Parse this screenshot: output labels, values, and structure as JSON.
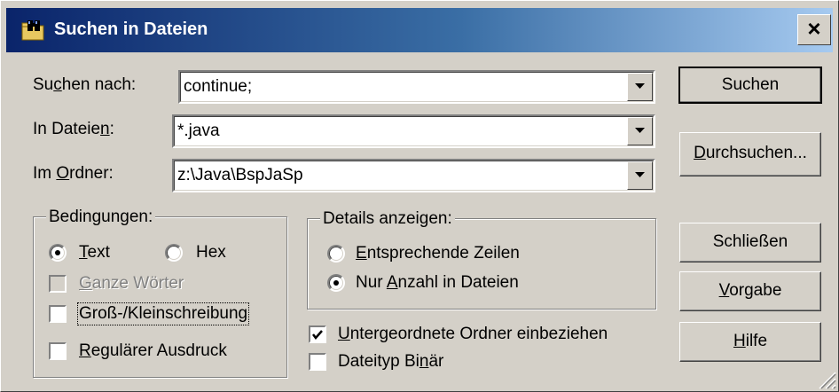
{
  "window": {
    "title": "Suchen in Dateien",
    "title_icon": "binoculars-folder-icon",
    "close_glyph": "×"
  },
  "fields": {
    "search": {
      "label_pre": "Su",
      "label_key": "c",
      "label_post": "hen nach:",
      "value": "continue;"
    },
    "files": {
      "label_pre": "In Dateie",
      "label_key": "n",
      "label_post": ":",
      "value": "*.java"
    },
    "folder": {
      "label_pre": "Im ",
      "label_key": "O",
      "label_post": "rdner:",
      "value": "z:\\Java\\BspJaSp"
    }
  },
  "buttons": {
    "search": "Suchen",
    "browse_key": "D",
    "browse_rest": "urchsuchen...",
    "close": "Schließen",
    "default_key": "V",
    "default_rest": "orgabe",
    "help_key": "H",
    "help_rest": "ilfe"
  },
  "conditions": {
    "legend": "Bedingungen:",
    "text_key": "T",
    "text_rest": "ext",
    "text_selected": true,
    "hex": "Hex",
    "hex_selected": false,
    "whole_words_key": "G",
    "whole_words_rest": "anze Wörter",
    "whole_words_checked": false,
    "whole_words_enabled": false,
    "case": "Groß-/Kleinschreibung",
    "case_checked": false,
    "regex_key": "R",
    "regex_rest": "egulärer Ausdruck",
    "regex_checked": false
  },
  "details": {
    "legend": "Details anzeigen:",
    "matching_key": "E",
    "matching_rest": "ntsprechende Zeilen",
    "matching_selected": false,
    "count_pre": "Nur ",
    "count_key": "A",
    "count_rest": "nzahl in Dateien",
    "count_selected": true
  },
  "options": {
    "subfolders_key": "U",
    "subfolders_rest": "ntergeordnete Ordner einbeziehen",
    "subfolders_checked": true,
    "binary_pre": "Dateityp Bi",
    "binary_key": "n",
    "binary_rest": "är",
    "binary_checked": false
  },
  "colors": {
    "face": "#d4d0c8",
    "title_start": "#0a246a",
    "title_end": "#a6caf0"
  }
}
